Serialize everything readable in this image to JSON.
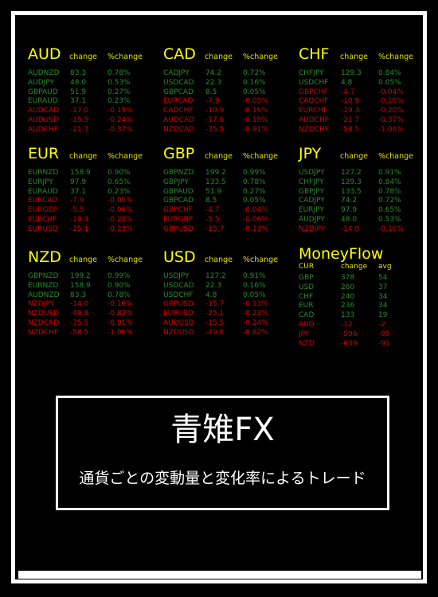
{
  "headers": {
    "change": "change",
    "pct": "%change"
  },
  "colors": {
    "positive": "#2a8a2a",
    "negative": "#d00000",
    "heading": "#ffff00"
  },
  "panels": [
    {
      "currency": "AUD",
      "rows": [
        [
          "AUDNZD",
          "83.3",
          "0.78%"
        ],
        [
          "AUDJPY",
          "48.0",
          "0.53%"
        ],
        [
          "GBPAUD",
          "51.9",
          "0.27%"
        ],
        [
          "EURAUD",
          "37.1",
          "0.23%"
        ],
        [
          "AUDCAD",
          "-17.0",
          "-0.19%"
        ],
        [
          "AUDUSD",
          "-15.5",
          "-0.24%"
        ],
        [
          "AUDCHF",
          "-21.7",
          "-0.37%"
        ]
      ]
    },
    {
      "currency": "CAD",
      "rows": [
        [
          "CADJPY",
          "74.2",
          "0.72%"
        ],
        [
          "USDCAD",
          "22.3",
          "0.16%"
        ],
        [
          "GBPCAD",
          "8.5",
          "0.05%"
        ],
        [
          "EURCAD",
          "-7.9",
          "-0.05%"
        ],
        [
          "CADCHF",
          "-10.9",
          "-0.16%"
        ],
        [
          "AUDCAD",
          "-17.0",
          "-0.19%"
        ],
        [
          "NZDCAD",
          "-75.5",
          "-0.91%"
        ]
      ]
    },
    {
      "currency": "CHF",
      "rows": [
        [
          "CHFJPY",
          "129.3",
          "0.84%"
        ],
        [
          "USDCHF",
          "4.8",
          "0.05%"
        ],
        [
          "GBPCHF",
          "-4.7",
          "-0.04%"
        ],
        [
          "CADCHF",
          "-10.9",
          "-0.16%"
        ],
        [
          "EURCHF",
          "-19.3",
          "-0.20%"
        ],
        [
          "AUDCHF",
          "-21.7",
          "-0.37%"
        ],
        [
          "NZDCHF",
          "-58.5",
          "-1.06%"
        ]
      ]
    },
    {
      "currency": "EUR",
      "rows": [
        [
          "EURNZD",
          "158.9",
          "0.90%"
        ],
        [
          "EURJPY",
          "97.9",
          "0.65%"
        ],
        [
          "EURAUD",
          "37.1",
          "0.23%"
        ],
        [
          "EURCAD",
          "-7.9",
          "-0.05%"
        ],
        [
          "EURGBP",
          "-5.5",
          "-0.06%"
        ],
        [
          "EURCHF",
          "-19.3",
          "-0.20%"
        ],
        [
          "EURUSD",
          "-25.1",
          "-0.23%"
        ]
      ]
    },
    {
      "currency": "GBP",
      "rows": [
        [
          "GBPNZD",
          "199.2",
          "0.99%"
        ],
        [
          "GBPJPY",
          "133.5",
          "0.78%"
        ],
        [
          "GBPAUD",
          "51.9",
          "0.27%"
        ],
        [
          "GBPCAD",
          "8.5",
          "0.05%"
        ],
        [
          "GBPCHF",
          "-4.7",
          "-0.04%"
        ],
        [
          "EURGBP",
          "-5.5",
          "-0.06%"
        ],
        [
          "GBPUSD",
          "-15.7",
          "-0.13%"
        ]
      ]
    },
    {
      "currency": "JPY",
      "rows": [
        [
          "USDJPY",
          "127.2",
          "0.91%"
        ],
        [
          "CHFJPY",
          "129.3",
          "0.84%"
        ],
        [
          "GBPJPY",
          "133.5",
          "0.78%"
        ],
        [
          "CADJPY",
          "74.2",
          "0.72%"
        ],
        [
          "EURJPY",
          "97.9",
          "0.65%"
        ],
        [
          "AUDJPY",
          "48.0",
          "0.53%"
        ],
        [
          "NZDJPY",
          "-14.0",
          "-0.16%"
        ]
      ]
    },
    {
      "currency": "NZD",
      "rows": [
        [
          "GBPNZD",
          "199.2",
          "0.99%"
        ],
        [
          "EURNZD",
          "158.9",
          "0.90%"
        ],
        [
          "AUDNZD",
          "83.3",
          "0.78%"
        ],
        [
          "NZDJPY",
          "-14.0",
          "-0.16%"
        ],
        [
          "NZDUSD",
          "-49.8",
          "-0.82%"
        ],
        [
          "NZDCAD",
          "-75.5",
          "-0.91%"
        ],
        [
          "NZDCHF",
          "-58.5",
          "-1.06%"
        ]
      ]
    },
    {
      "currency": "USD",
      "rows": [
        [
          "USDJPY",
          "127.2",
          "0.91%"
        ],
        [
          "USDCAD",
          "22.3",
          "0.16%"
        ],
        [
          "USDCHF",
          "4.8",
          "0.05%"
        ],
        [
          "GBPUSD",
          "-15.7",
          "-0.13%"
        ],
        [
          "EURUSD",
          "-25.1",
          "-0.23%"
        ],
        [
          "AUDUSD",
          "-15.5",
          "-0.24%"
        ],
        [
          "NZDUSD",
          "-49.8",
          "-0.82%"
        ]
      ]
    }
  ],
  "moneyflow": {
    "title": "MoneyFlow",
    "columns": [
      "CUR",
      "change",
      "avg"
    ],
    "rows": [
      [
        "GBP",
        "378",
        "54"
      ],
      [
        "USD",
        "260",
        "37"
      ],
      [
        "CHF",
        "240",
        "34"
      ],
      [
        "EUR",
        "236",
        "34"
      ],
      [
        "CAD",
        "133",
        "19"
      ],
      [
        "AUD",
        "-12",
        "-2"
      ],
      [
        "JPY",
        "-596",
        "-85"
      ],
      [
        "NZD",
        "-639",
        "-91"
      ]
    ]
  },
  "banner": {
    "title": "青雉FX",
    "subtitle": "通貨ごとの変動量と変化率によるトレード"
  }
}
